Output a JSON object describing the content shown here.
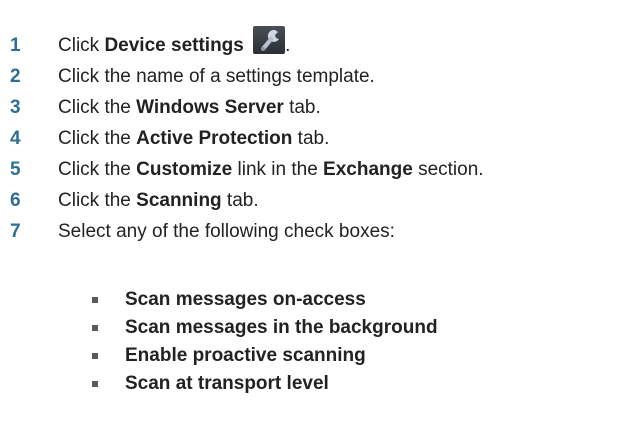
{
  "steps": [
    {
      "num": "1",
      "pre": "Click ",
      "bold": "Device settings",
      "post": "",
      "after_icon": ".",
      "icon": "wrench-icon"
    },
    {
      "num": "2",
      "pre": "Click the name of a settings template.",
      "bold": "",
      "post": ""
    },
    {
      "num": "3",
      "pre": "Click the ",
      "bold": "Windows Server",
      "post": " tab."
    },
    {
      "num": "4",
      "pre": "Click the ",
      "bold": "Active Protection",
      "post": " tab."
    },
    {
      "num": "5",
      "pre": "Click the ",
      "bold": "Customize",
      "post": " link in the ",
      "bold2": "Exchange",
      "post2": " section."
    },
    {
      "num": "6",
      "pre": "Click the ",
      "bold": "Scanning",
      "post": " tab."
    },
    {
      "num": "7",
      "pre": "Select any of the following check boxes:",
      "bold": "",
      "post": ""
    }
  ],
  "options": [
    "Scan messages on-access",
    "Scan messages in the background",
    "Enable proactive scanning",
    "Scan at transport level"
  ],
  "colors": {
    "step_number": "#2e6f93",
    "text": "#222222",
    "bullet": "#5a5a5a"
  }
}
